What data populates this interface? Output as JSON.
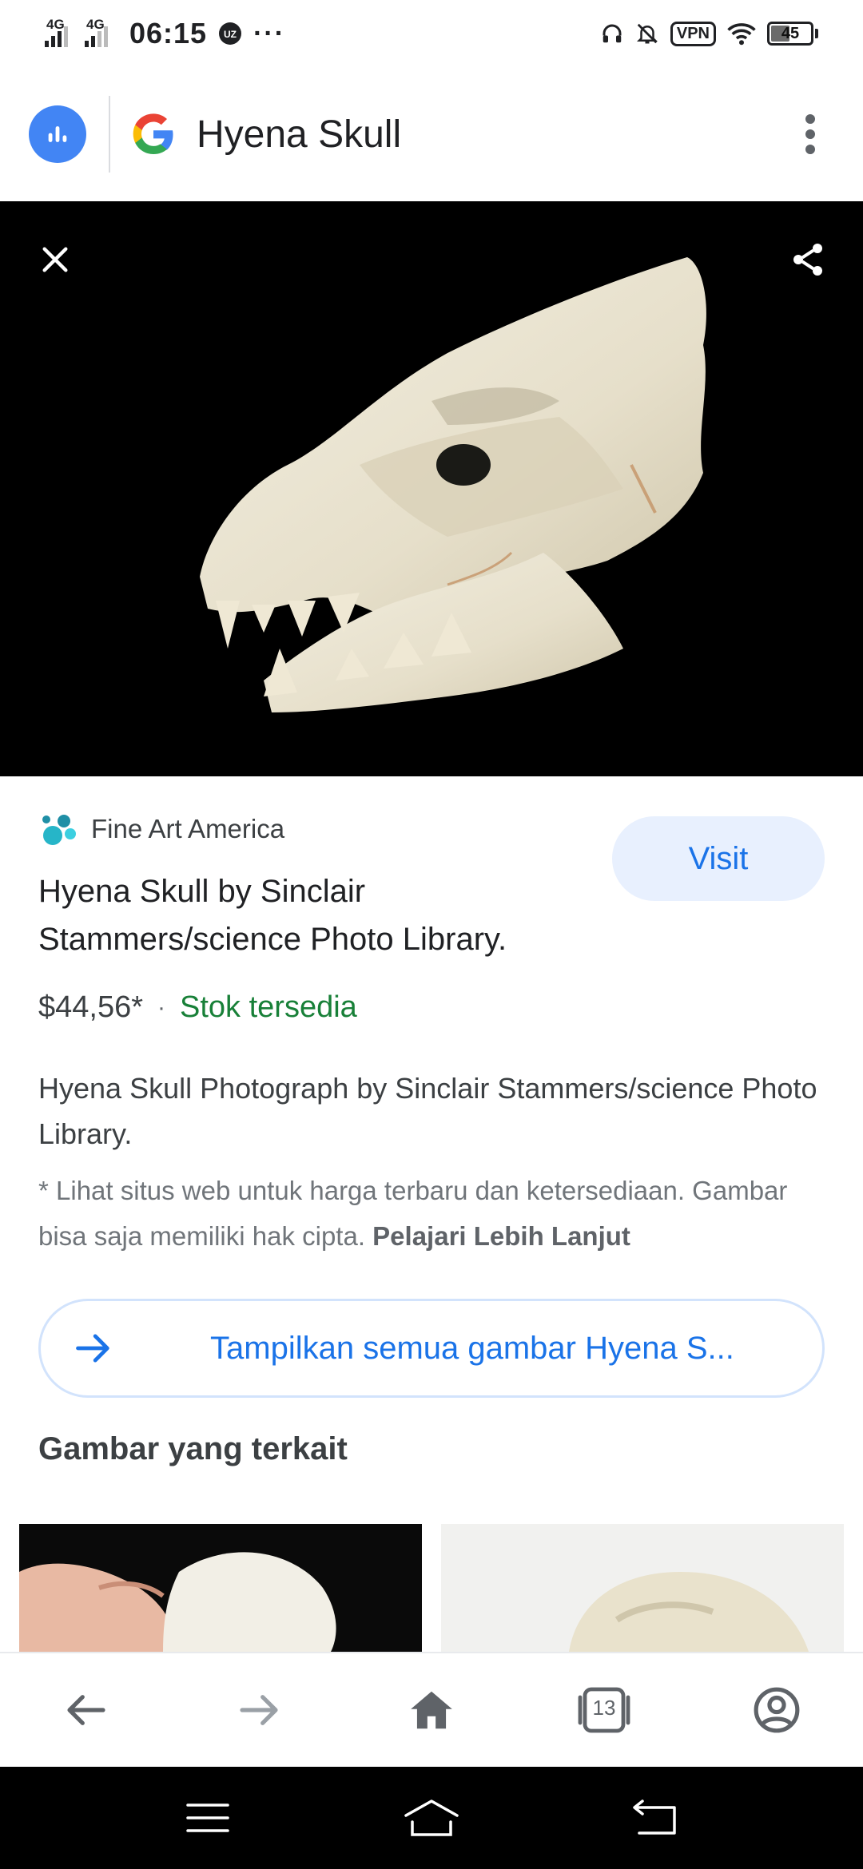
{
  "status_bar": {
    "signal1": "4G",
    "signal2": "4G",
    "time": "06:15",
    "more": "···",
    "vpn": "VPN",
    "battery": "45",
    "battery_level": 0.45
  },
  "app_bar": {
    "query": "Hyena Skull",
    "icons": [
      "lens-icon",
      "google-logo-icon",
      "more-vert-icon"
    ]
  },
  "viewer": {
    "icons": [
      "close-icon",
      "share-icon"
    ]
  },
  "result": {
    "source": "Fine Art America",
    "visit_label": "Visit",
    "title": "Hyena Skull by Sinclair Stammers/science Photo Library.",
    "price": "$44,56*",
    "separator": "·",
    "stock": "Stok tersedia",
    "description": "Hyena Skull Photograph by Sinclair Stammers/science Photo Library.",
    "disclaimer": "* Lihat situs web untuk harga terbaru dan ketersediaan. Gambar bisa saja memiliki hak cipta.",
    "learn_more": "Pelajari Lebih Lanjut",
    "all_images": "Tampilkan semua gambar Hyena S...",
    "related_heading": "Gambar yang terkait"
  },
  "toolbar": {
    "tab_count": "13",
    "icons": [
      "back-icon",
      "forward-icon",
      "home-icon",
      "tabs-icon",
      "account-icon"
    ]
  },
  "colors": {
    "accent": "#1a73e8",
    "accent_bg": "#e8f0fe",
    "stock": "#188038",
    "lens": "#4285f4"
  }
}
